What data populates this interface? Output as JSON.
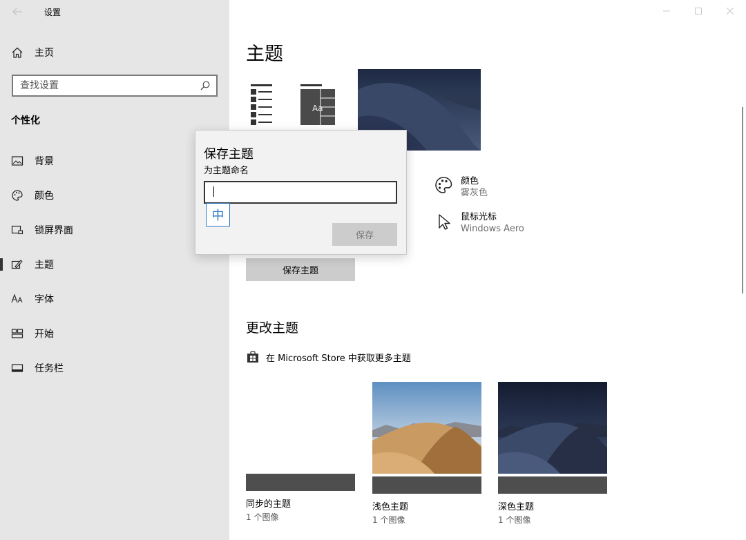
{
  "window": {
    "title": "设置",
    "controls": [
      "minimize-icon",
      "maximize-icon",
      "close-icon"
    ]
  },
  "sidebar": {
    "home_label": "主页",
    "search_placeholder": "查找设置",
    "section_heading": "个性化",
    "items": [
      {
        "label": "背景",
        "icon": "picture-icon"
      },
      {
        "label": "颜色",
        "icon": "palette-icon"
      },
      {
        "label": "锁屏界面",
        "icon": "lock-screen-icon"
      },
      {
        "label": "主题",
        "icon": "theme-brush-icon",
        "selected": true
      },
      {
        "label": "字体",
        "icon": "font-icon"
      },
      {
        "label": "开始",
        "icon": "start-icon"
      },
      {
        "label": "任务栏",
        "icon": "taskbar-icon"
      }
    ]
  },
  "main": {
    "title": "主题",
    "preview_sample_text": "Aa",
    "properties": {
      "color": {
        "name": "颜色",
        "value": "雾灰色",
        "icon": "palette-icon"
      },
      "cursor": {
        "name": "鼠标光标",
        "value": "Windows Aero",
        "icon": "cursor-icon"
      }
    },
    "save_theme_label": "保存主题",
    "change_heading": "更改主题",
    "store_link": "在 Microsoft Store 中获取更多主题",
    "themes": [
      {
        "name": "同步的主题",
        "count": "1 个图像"
      },
      {
        "name": "浅色主题",
        "count": "1 个图像"
      },
      {
        "name": "深色主题",
        "count": "1 个图像"
      }
    ]
  },
  "dialog": {
    "title": "保存主题",
    "subtitle": "为主题命名",
    "input_value": "",
    "ime_indicator": "中",
    "save_label": "保存"
  },
  "colors": {
    "sidebar_bg": "#e6e6e6",
    "button_bg": "#cccccc",
    "tile_strip": "#4e4e4e",
    "ime_blue": "#2b77c4"
  }
}
